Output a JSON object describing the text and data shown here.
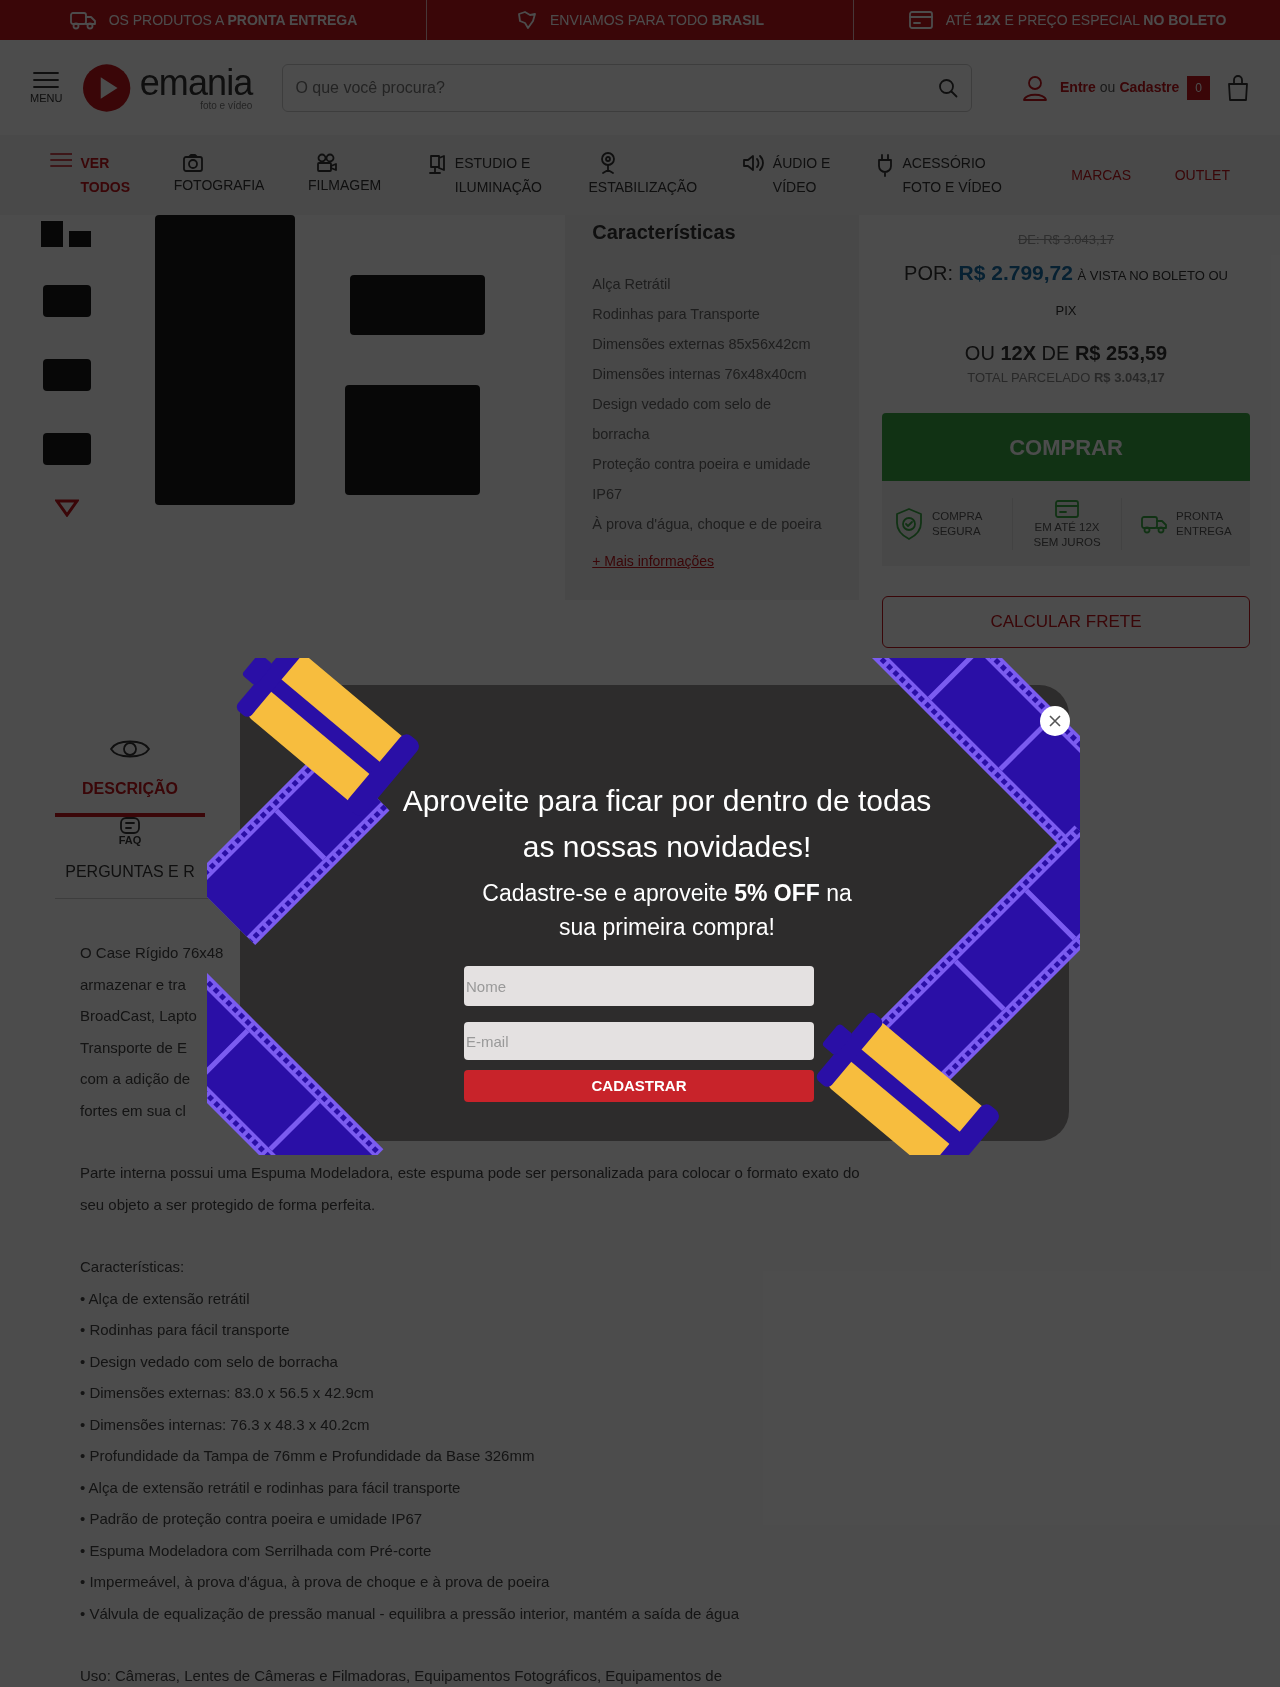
{
  "promo_bar": [
    {
      "text": "OS PRODUTOS A **PRONTA ENTREGA**"
    },
    {
      "text": "ENVIAMOS PARA TODO **BRASIL**"
    },
    {
      "text": "ATÉ **12X** E PREÇO ESPECIAL **NO BOLETO**"
    }
  ],
  "header": {
    "menu_label": "MENU",
    "logo_name": "emania",
    "logo_tagline": "foto e vídeo",
    "search": {
      "placeholder": "O que você procura?"
    },
    "login_link": "Entre",
    "login_separator": "ou",
    "signup_link": "Cadastre",
    "cart_count": "0"
  },
  "nav": [
    {
      "label": "VER TODOS",
      "kind": "menu",
      "highlight": true
    },
    {
      "label": "FOTOGRAFIA",
      "kind": "camera",
      "highlight": false
    },
    {
      "label": "FILMAGEM",
      "kind": "film",
      "highlight": false
    },
    {
      "label": "ESTUDIO E ILUMINAÇÃO",
      "kind": "light",
      "highlight": false
    },
    {
      "label": "ESTABILIZAÇÃO",
      "kind": "gimbal",
      "highlight": false
    },
    {
      "label": "ÁUDIO E VÍDEO",
      "kind": "audio",
      "highlight": false
    },
    {
      "label": "ACESSÓRIO FOTO E VÍDEO",
      "kind": "plug",
      "highlight": false
    },
    {
      "label": "MARCAS",
      "kind": "text",
      "highlight": true
    },
    {
      "label": "OUTLET",
      "kind": "text",
      "highlight": true
    }
  ],
  "features": {
    "title": "Características",
    "items": [
      "Alça Retrátil",
      "Rodinhas para Transporte",
      "Dimensões externas 85x56x42cm",
      "Dimensões internas 76x48x40cm",
      "Design vedado com selo de borracha",
      "Proteção contra poeira e umidade IP67",
      "À prova d'água, choque e de poeira"
    ],
    "more_link": "+ Mais informações"
  },
  "price": {
    "old_price": "DE: R$ 3.043,17",
    "por_label": "POR:",
    "price": "R$ 2.799,72",
    "price_note": "À VISTA NO BOLETO OU PIX",
    "installments": "OU **12X** DE **R$ 253,59**",
    "total": "TOTAL PARCELADO **R$ 3.043,17**",
    "buy_button": "COMPRAR",
    "badges": [
      "COMPRA SEGURA",
      "EM ATÉ 12X SEM JUROS",
      "PRONTA ENTREGA"
    ],
    "shipping_button": "CALCULAR FRETE"
  },
  "tabs": [
    {
      "label": "DESCRIÇÃO",
      "selected": true
    },
    {
      "label": "PERGUNTAS E R",
      "icon_text": "FAQ",
      "selected": false
    }
  ],
  "description": {
    "intro_lines": [
      "O Case Rígido 76x48",
      "armazenar e tra",
      "BroadCast, Lapto",
      "Transporte de E",
      "com a adição de",
      "fortes em sua cl"
    ],
    "paragraph": "Parte interna possui uma Espuma Modeladora, este espuma pode ser personalizada para colocar o formato exato do seu objeto a ser protegido de forma perfeita.",
    "list_title": "Características:",
    "list": [
      "• Alça de extensão retrátil",
      "• Rodinhas para fácil transporte",
      "• Design vedado com selo de borracha",
      "• Dimensões externas:  83.0 x 56.5 x 42.9cm",
      "• Dimensões internas:  76.3 x 48.3 x 40.2cm",
      "• Profundidade da Tampa de 76mm e Profundidade da Base 326mm",
      "• Alça de extensão retrátil e rodinhas para fácil transporte",
      "• Padrão de proteção contra poeira e umidade IP67",
      "• Espuma Modeladora com Serrilhada com Pré-corte",
      "• Impermeável, à prova d'água, à prova de choque e à prova de poeira",
      "• Válvula de equalização de pressão manual - equilibra a pressão interior, mantém a saída de água"
    ],
    "usage": "Uso: Câmeras, Lentes de Câmeras e Filmadoras, Equipamentos Fotográficos, Equipamentos de"
  },
  "popup": {
    "title": "Aproveite para ficar por dentro de todas as nossas novidades!",
    "subtitle": "Cadastre-se e aproveite **5% OFF** na sua primeira compra!",
    "name_field": {
      "placeholder": "Nome"
    },
    "email_field": {
      "placeholder": "E-mail"
    },
    "submit_button": "CADASTRAR"
  }
}
